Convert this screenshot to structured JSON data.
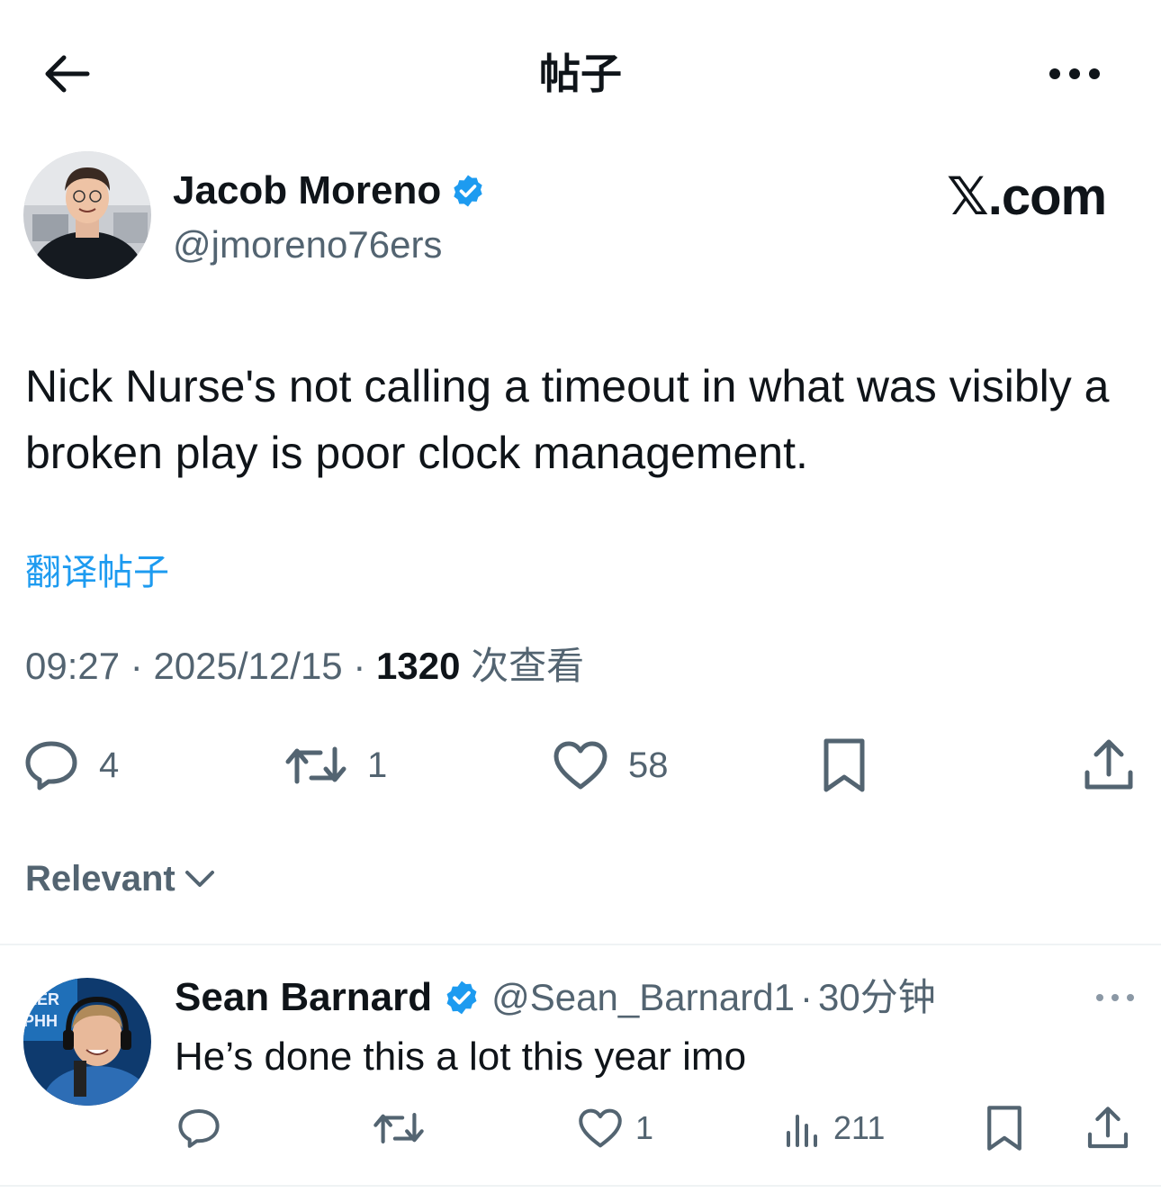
{
  "header": {
    "title": "帖子"
  },
  "tweet": {
    "author_name": "Jacob Moreno",
    "author_handle": "@jmoreno76ers",
    "brand": "𝕏.com",
    "text": "Nick Nurse's not calling a timeout in what was visibly a broken play is poor clock management.",
    "translate_label": "翻译帖子",
    "time": "09:27",
    "date": "2025/12/15",
    "views_count": "1320",
    "views_label": "次查看",
    "separator": "·",
    "actions": {
      "replies": "4",
      "reposts": "1",
      "likes": "58"
    }
  },
  "sort": {
    "label": "Relevant"
  },
  "reply": {
    "author_name": "Sean Barnard",
    "author_handle": "@Sean_Barnard1",
    "time": "30分钟",
    "separator": "·",
    "text": "He’s done this a lot this year imo",
    "actions": {
      "likes": "1",
      "views": "211"
    }
  },
  "colors": {
    "accent": "#1d9bf0",
    "secondary_text": "#536471",
    "primary_text": "#0f1419",
    "divider": "#eff3f4"
  },
  "icons": {
    "back": "arrow-left-icon",
    "more": "more-horizontal-icon",
    "verified": "verified-badge-icon",
    "reply": "reply-icon",
    "repost": "repost-icon",
    "like": "heart-icon",
    "bookmark": "bookmark-icon",
    "share": "share-icon",
    "views": "analytics-icon",
    "chevron": "chevron-down-icon"
  }
}
